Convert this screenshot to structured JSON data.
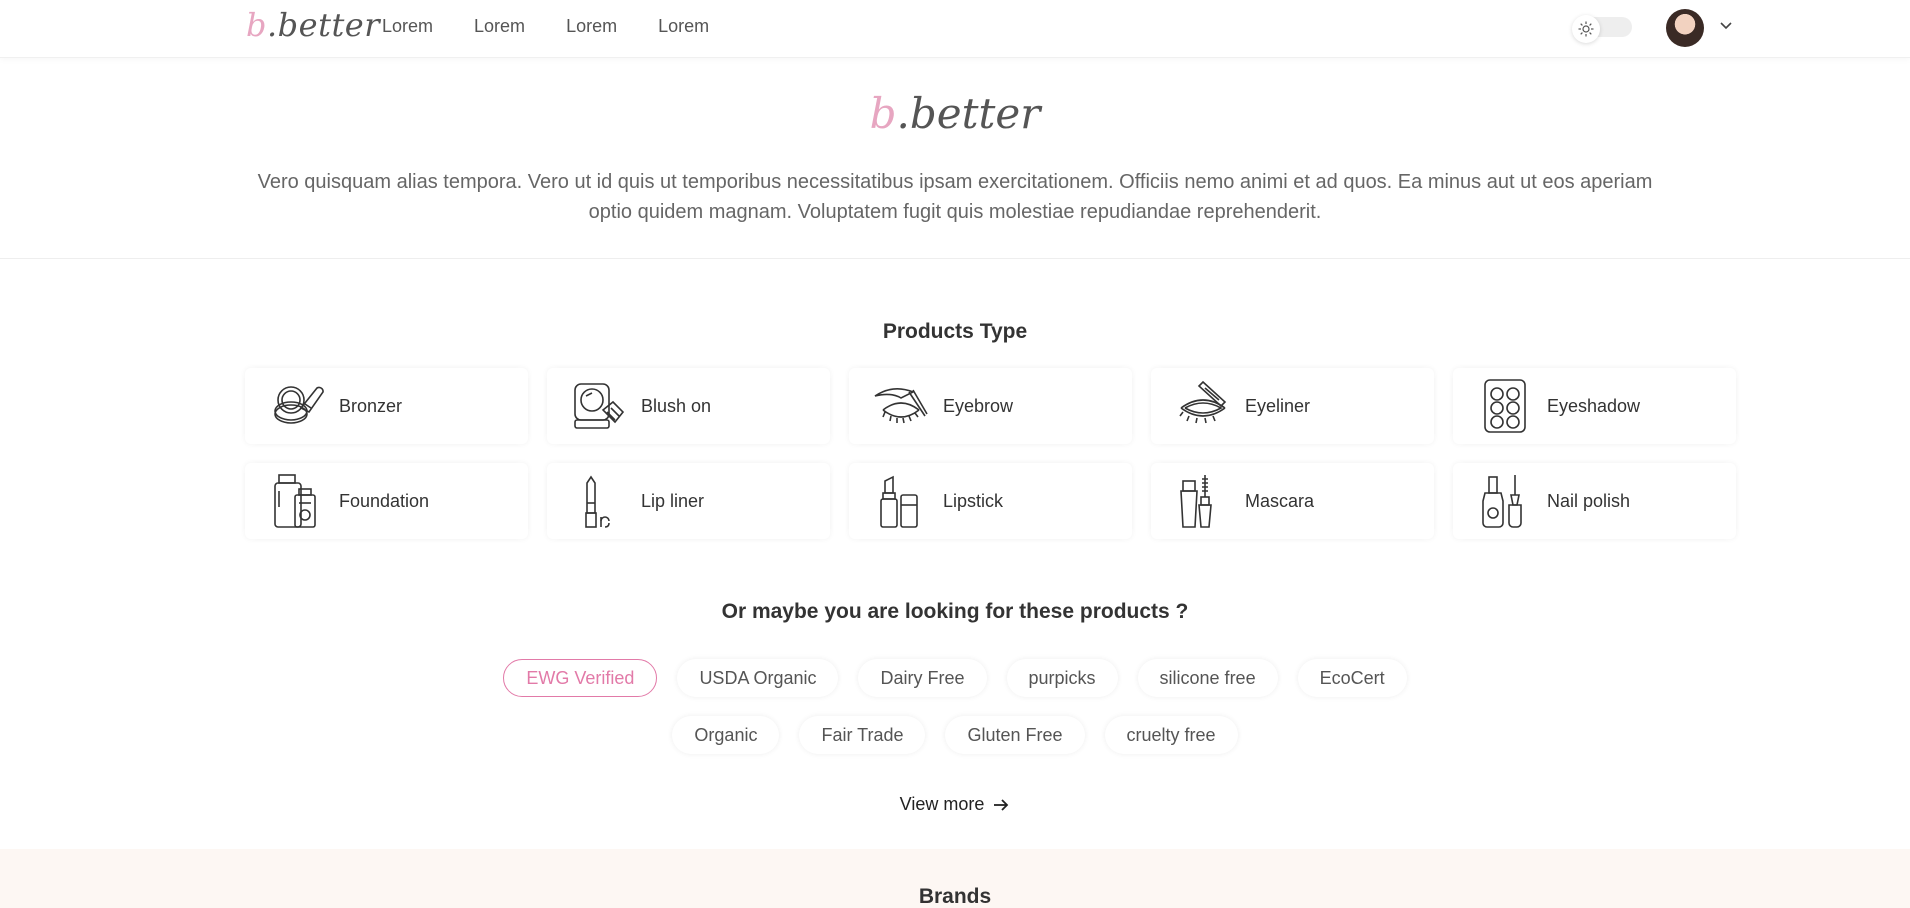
{
  "header": {
    "logo_b": "b",
    "logo_rest": ".better",
    "nav": [
      "Lorem",
      "Lorem",
      "Lorem",
      "Lorem"
    ]
  },
  "hero": {
    "logo_b": "b",
    "logo_rest": ".better",
    "description": "Vero quisquam alias tempora. Vero ut id quis ut temporibus necessitatibus ipsam exercitationem. Officiis nemo animi et ad quos. Ea minus aut ut eos aperiam optio quidem magnam. Voluptatem fugit quis molestiae repudiandae reprehenderit."
  },
  "products": {
    "title": "Products Type",
    "items": [
      {
        "label": "Bronzer",
        "icon": "bronzer-icon"
      },
      {
        "label": "Blush on",
        "icon": "blush-icon"
      },
      {
        "label": "Eyebrow",
        "icon": "eyebrow-icon"
      },
      {
        "label": "Eyeliner",
        "icon": "eyeliner-icon"
      },
      {
        "label": "Eyeshadow",
        "icon": "eyeshadow-icon"
      },
      {
        "label": "Foundation",
        "icon": "foundation-icon"
      },
      {
        "label": "Lip liner",
        "icon": "lip-liner-icon"
      },
      {
        "label": "Lipstick",
        "icon": "lipstick-icon"
      },
      {
        "label": "Mascara",
        "icon": "mascara-icon"
      },
      {
        "label": "Nail polish",
        "icon": "nail-polish-icon"
      }
    ]
  },
  "tags": {
    "title": "Or maybe you are looking for these products ?",
    "row1": [
      "EWG Verified",
      "USDA Organic",
      "Dairy Free",
      "purpicks",
      "silicone free",
      "EcoCert"
    ],
    "row2": [
      "Organic",
      "Fair Trade",
      "Gluten Free",
      "cruelty free"
    ],
    "active": "EWG Verified",
    "accent": "#e27aa8"
  },
  "view_more": "View more",
  "brands": {
    "title": "Brands"
  }
}
